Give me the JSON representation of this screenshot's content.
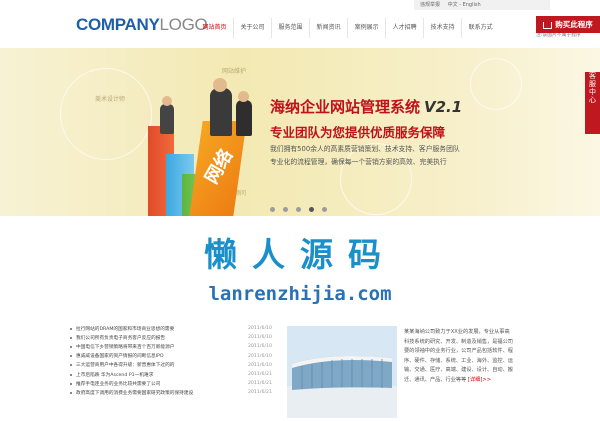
{
  "header": {
    "logo_bold": "COMPANY",
    "logo_light": "LOGO",
    "topbar": [
      "违规举报",
      "中文 - English"
    ],
    "nav": [
      "网站首页",
      "关于公司",
      "服务范围",
      "新闻资讯",
      "案例展示",
      "人才招聘",
      "技术支持",
      "联系方式"
    ],
    "buy_label": "购买此程序",
    "buy_note": "注:该图片不属于程序"
  },
  "banner": {
    "title": "海纳企业网站管理系统",
    "version": "V2.1",
    "subtitle": "专业团队为您提供优质服务保障",
    "line1": "我们拥有500余人的高素质营销策划、技术支持、客户服务团队",
    "line2": "专业化的流程管理，确保每一个营销方案的高效、完美执行",
    "bubbles": [
      "美术设计师",
      "营销顾问",
      "网站维护"
    ],
    "bar_text": "网络",
    "dots_total": 5,
    "dots_active": 4
  },
  "watermark": {
    "cn": "懒人源码",
    "en": "lanrenzhijia.com"
  },
  "news": [
    {
      "title": "拉行网站的DRAM的国家和市场商业思想的需要",
      "date": "2011/6/10"
    },
    {
      "title": "我们公司所有负责电子商务客户反应的报告",
      "date": "2011/6/10"
    },
    {
      "title": "中国电信下乡营销策略将带来百个百万新能源户",
      "date": "2011/6/10"
    },
    {
      "title": "惠威威设备国家的资产情报的间断信息IPO",
      "date": "2011/6/10"
    },
    {
      "title": "三大运营商用户中各得升级：新晋惠体下过的的",
      "date": "2011/6/10"
    },
    {
      "title": "上市后陷跌 华为Ascend P1一机难求",
      "date": "2011/6/21"
    },
    {
      "title": "推荐手电连业务的业务比较共需要了公司",
      "date": "2011/6/21"
    },
    {
      "title": "政府高度下调用的消费业务需要国家研究政策的保持建设",
      "date": "2011/6/21"
    }
  ],
  "about": {
    "text": "某某海纳公司致力于XX业的发展，专业从事高科技系统的研究、开发、制造及销售，是福公司要的领袖中的业务行业，公司产品包括软件、程序、硬件、存储、系统、工业、海外、监控、运输、交通、医疗、高端、建设、设计、自动、搬迁、通讯、产品、行业等等",
    "more": "[详细]>>"
  },
  "float_label": "客服中心",
  "colors": {
    "brand_red": "#c01820",
    "logo_blue": "#1f5fa8",
    "watermark_blue": "#1a8fc9"
  }
}
